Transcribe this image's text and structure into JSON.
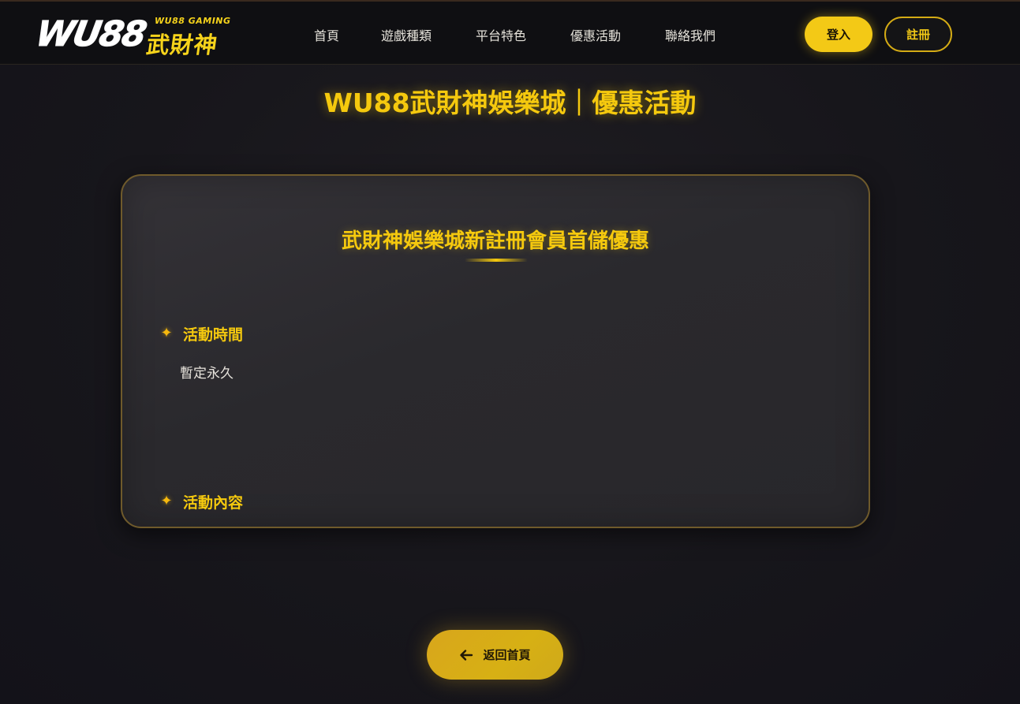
{
  "header": {
    "logo_mark": "WU88",
    "logo_sub": "WU88 GAMING",
    "logo_cn": "武財神",
    "nav": [
      "首頁",
      "遊戲種類",
      "平台特色",
      "優惠活動",
      "聯絡我們"
    ],
    "login_label": "登入",
    "register_label": "註冊"
  },
  "page": {
    "title": "WU88武財神娛樂城｜優惠活動"
  },
  "card": {
    "title": "武財神娛樂城新註冊會員首儲優惠",
    "sections": [
      {
        "label": "活動時間",
        "text": "暫定永久"
      },
      {
        "label": "活動內容"
      }
    ]
  },
  "back_button": {
    "label": "返回首頁"
  },
  "colors": {
    "accent": "#f5c90e",
    "background": "#17161b",
    "card_border": "#6f5a2b"
  },
  "icons": {
    "sparkle": "sparkle-icon",
    "back": "arrow-left-icon"
  }
}
